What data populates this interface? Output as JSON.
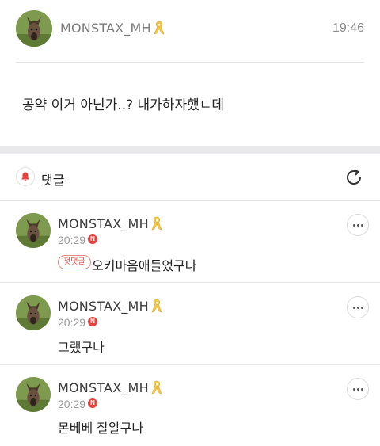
{
  "post": {
    "author": "MONSTAX_MH",
    "time": "19:46",
    "body": "공약 이거 아닌가..? 내가하자했ㄴ데"
  },
  "comments_section": {
    "title": "댓글"
  },
  "comments": [
    {
      "author": "MONSTAX_MH",
      "time": "20:29",
      "badge": "N",
      "tag": "첫댓글",
      "text": "오키마음애들었구나"
    },
    {
      "author": "MONSTAX_MH",
      "time": "20:29",
      "badge": "N",
      "text": "그랬구나"
    },
    {
      "author": "MONSTAX_MH",
      "time": "20:29",
      "badge": "N",
      "text": "몬베베 잘알구나"
    }
  ],
  "colors": {
    "accent_red": "#e8403c",
    "ribbon_yellow": "#f2c94c",
    "separator_gray": "#e9e9ec"
  },
  "icons": {
    "author_badge": "yellow-ribbon-icon",
    "notification": "bell-icon",
    "refresh": "refresh-icon",
    "more": "more-horizontal-icon"
  }
}
